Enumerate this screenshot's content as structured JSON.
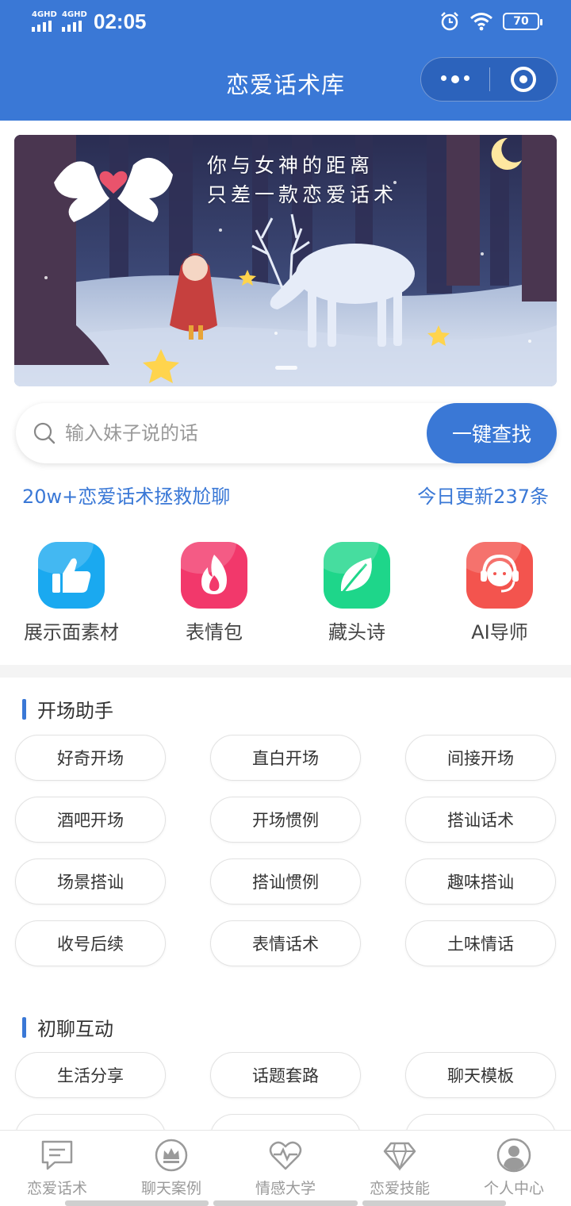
{
  "status_bar": {
    "network1": "4GHD",
    "network2": "4GHD",
    "time": "02:05",
    "battery": "70"
  },
  "header": {
    "title": "恋爱话术库"
  },
  "banner": {
    "line1": "你与女神的距离",
    "line2": "只差一款恋爱话术"
  },
  "search": {
    "placeholder": "输入妹子说的话",
    "button": "一键查找"
  },
  "promo": {
    "left": "20w+恋爱话术拯救尬聊",
    "right": "今日更新237条"
  },
  "quick_actions": [
    {
      "label": "展示面素材",
      "icon": "thumbs-up-icon",
      "color": "#1aa9f0"
    },
    {
      "label": "表情包",
      "icon": "flame-icon",
      "color": "#f2386b"
    },
    {
      "label": "藏头诗",
      "icon": "leaf-icon",
      "color": "#1ed68a"
    },
    {
      "label": "AI导师",
      "icon": "headset-icon",
      "color": "#f3544e"
    }
  ],
  "sections": [
    {
      "title": "开场助手",
      "tags": [
        "好奇开场",
        "直白开场",
        "间接开场",
        "酒吧开场",
        "开场惯例",
        "搭讪话术",
        "场景搭讪",
        "搭讪惯例",
        "趣味搭讪",
        "收号后续",
        "表情话术",
        "土味情话"
      ]
    },
    {
      "title": "初聊互动",
      "tags": [
        "生活分享",
        "话题套路",
        "聊天模板"
      ]
    }
  ],
  "tabbar": [
    {
      "label": "恋爱话术",
      "icon": "chat-bubble-icon"
    },
    {
      "label": "聊天案例",
      "icon": "crown-icon"
    },
    {
      "label": "情感大学",
      "icon": "heart-pulse-icon"
    },
    {
      "label": "恋爱技能",
      "icon": "diamond-icon"
    },
    {
      "label": "个人中心",
      "icon": "user-icon"
    }
  ]
}
